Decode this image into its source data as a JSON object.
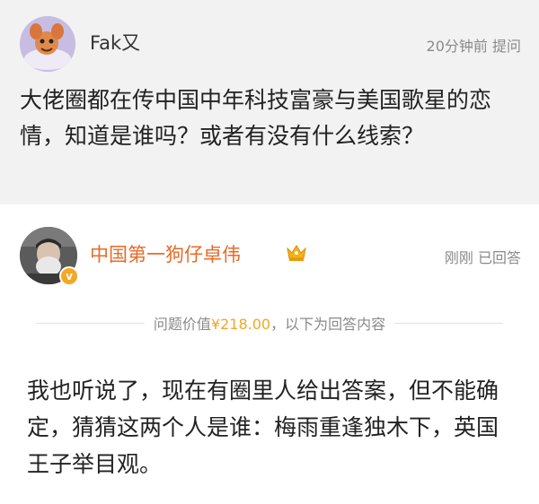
{
  "question": {
    "username": "Fak又",
    "time": "20分钟前",
    "action": "提问",
    "text": "大佬圈都在传中国中年科技富豪与美国歌星的恋情，知道是谁吗？或者有没有什么线索？"
  },
  "answer": {
    "username": "中国第一狗仔卓伟",
    "time": "刚刚",
    "status": "已回答",
    "value_prefix": "问题价值",
    "value_amount": "¥218.00",
    "value_suffix": "，以下为回答内容",
    "text": "我也听说了，现在有圈里人给出答案，但不能确定，猜猜这两个人是谁：梅雨重逢独木下，英国王子举目观。"
  },
  "colors": {
    "accent": "#e86a26",
    "amount": "#f5a623",
    "meta": "#8a8a8a",
    "question_bg": "#f2f2f2"
  },
  "icons": {
    "vip": "crown-icon",
    "verified": "verified-badge-icon"
  }
}
